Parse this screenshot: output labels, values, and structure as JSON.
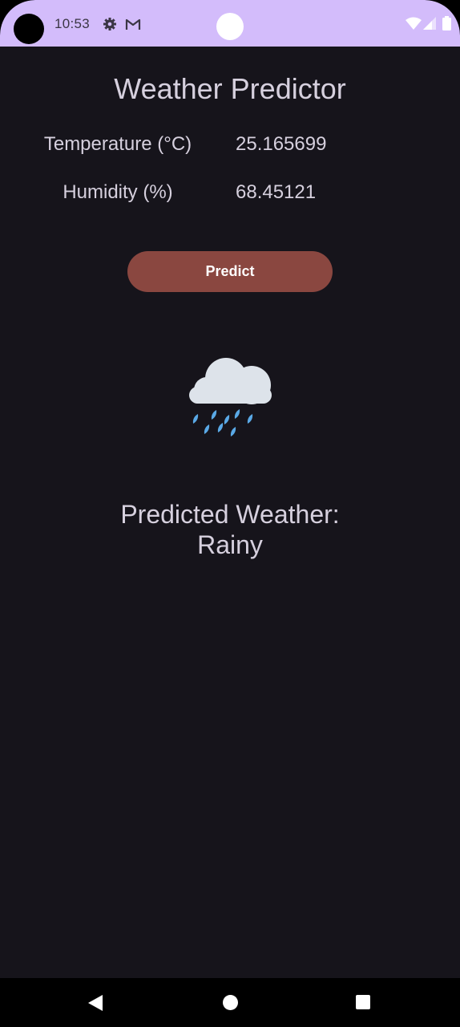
{
  "status_bar": {
    "time": "10:53",
    "icons": [
      "settings-gear-icon",
      "gmail-icon",
      "wifi-icon",
      "cell-signal-icon",
      "battery-icon"
    ],
    "background_color": "#d3bcfb"
  },
  "app": {
    "title": "Weather Predictor",
    "fields": [
      {
        "label": "Temperature (°C)",
        "value": "25.165699"
      },
      {
        "label": "Humidity (%)",
        "value": "68.45121"
      }
    ],
    "predict_button_label": "Predict",
    "predict_button_color": "#8a4740",
    "weather_icon": "rain-cloud-icon",
    "result_line_1": "Predicted Weather:",
    "result_line_2": "Rainy"
  },
  "nav_bar": {
    "buttons": [
      "back-icon",
      "home-icon",
      "recents-icon"
    ]
  }
}
